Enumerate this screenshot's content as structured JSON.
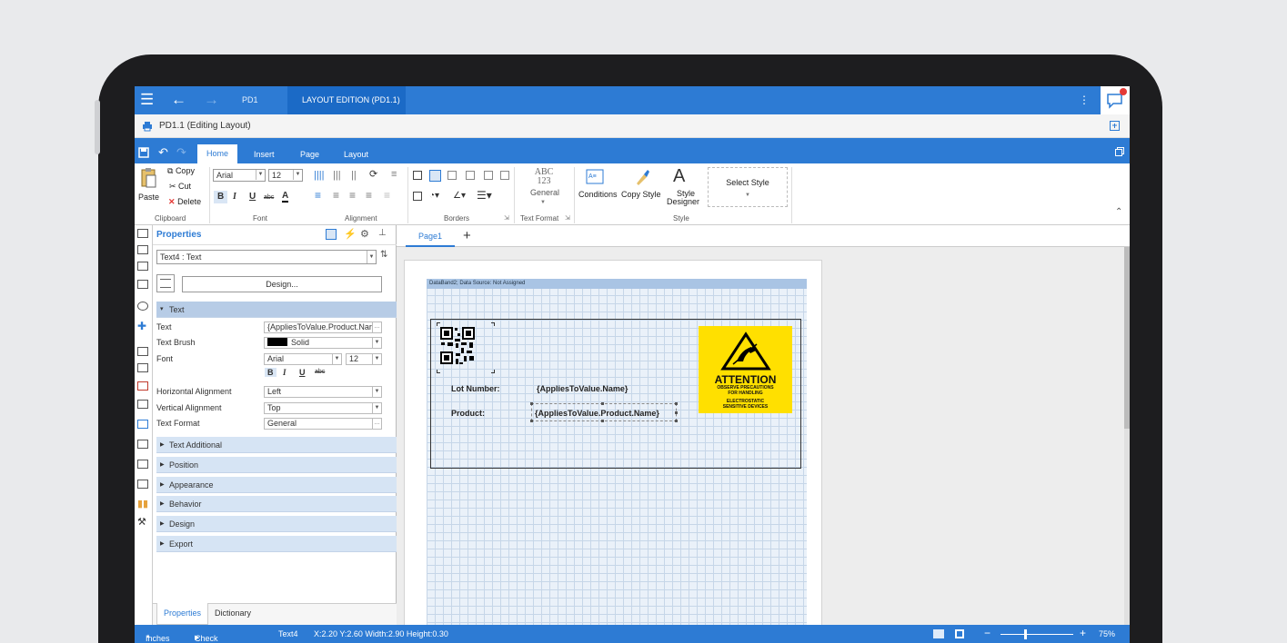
{
  "titlebar": {
    "tabs": [
      "PD1",
      "LAYOUT EDITION (PD1.1)"
    ],
    "close_glyph": "×"
  },
  "docbar": {
    "title": "PD1.1 (Editing Layout)"
  },
  "ribbon_tabs": [
    "Home",
    "Insert",
    "Page",
    "Layout"
  ],
  "ribbon": {
    "clipboard": {
      "paste": "Paste",
      "copy": "Copy",
      "cut": "Cut",
      "delete": "Delete",
      "label": "Clipboard"
    },
    "font": {
      "family": "Arial",
      "size": "12",
      "bold": "B",
      "italic": "I",
      "underline": "U",
      "strike": "abc",
      "color": "A",
      "label": "Font"
    },
    "alignment": {
      "label": "Alignment"
    },
    "borders": {
      "label": "Borders"
    },
    "text_format": {
      "sample": "ABC\n123",
      "value": "General",
      "label": "Text Format"
    },
    "style": {
      "conditions": "Conditions",
      "copy_style": "Copy Style",
      "designer_1": "Style",
      "designer_2": "Designer",
      "label": "Style"
    },
    "select_style": "Select Style"
  },
  "properties": {
    "title": "Properties",
    "selector": "Text4 : Text",
    "design_button": "Design...",
    "open_category": "Text",
    "rows": [
      {
        "label": "Text",
        "value": "{AppliesToValue.Product.Nar"
      },
      {
        "label": "Text Brush",
        "value": "Solid"
      },
      {
        "label": "Font",
        "value": "Arial",
        "size": "12"
      },
      {
        "label": "Horizontal Alignment",
        "value": "Left"
      },
      {
        "label": "Vertical Alignment",
        "value": "Top"
      },
      {
        "label": "Text Format",
        "value": "General"
      }
    ],
    "font_styles": {
      "bold": "B",
      "italic": "I",
      "underline": "U",
      "strike": "abc"
    },
    "categories": [
      "Text Additional",
      "Position",
      "Appearance",
      "Behavior",
      "Design",
      "Export"
    ],
    "bottom_tabs": [
      "Properties",
      "Dictionary"
    ]
  },
  "design": {
    "page_tab": "Page1",
    "add_tab": "+",
    "band_header": "DataBand2; Data Source: Not Assigned",
    "lot_label": "Lot Number:",
    "lot_value": "{AppliesToValue.Name}",
    "product_label": "Product:",
    "product_value": "{AppliesToValue.Product.Name}",
    "attention": {
      "title": "ATTENTION",
      "line1": "OBSERVE PRECAUTIONS",
      "line2": "FOR HANDLING",
      "line3": "ELECTROSTATIC",
      "line4": "SENSITIVE DEVICES"
    }
  },
  "statusbar": {
    "units": "Inches",
    "check": "Check for Issues",
    "component": "Text4",
    "coords": "X:2.20 Y:2.60 Width:2.90 Height:0.30",
    "zoom": "75%",
    "zoom_level": 0.75
  },
  "colors": {
    "accent": "#2d7bd4",
    "attention": "#ffe000"
  }
}
